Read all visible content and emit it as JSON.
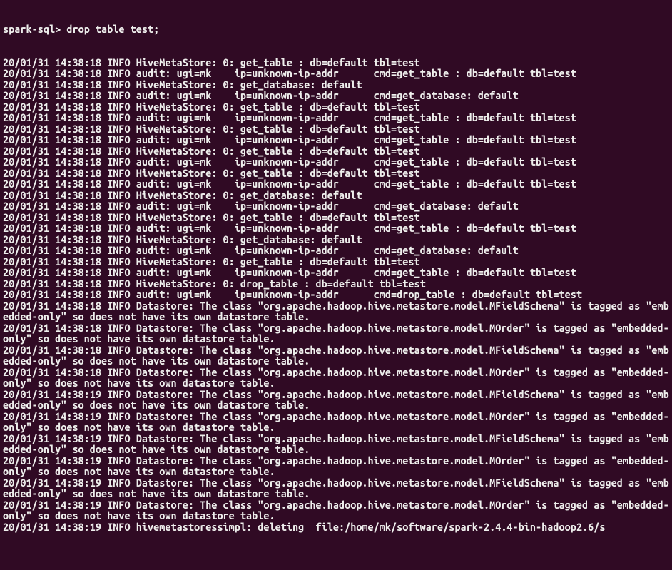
{
  "prompt": "spark-sql> ",
  "command": "drop table test;",
  "lines": [
    "20/01/31 14:38:18 INFO HiveMetaStore: 0: get_table : db=default tbl=test",
    "20/01/31 14:38:18 INFO audit: ugi=mk    ip=unknown-ip-addr      cmd=get_table : db=default tbl=test",
    "20/01/31 14:38:18 INFO HiveMetaStore: 0: get_database: default",
    "20/01/31 14:38:18 INFO audit: ugi=mk    ip=unknown-ip-addr      cmd=get_database: default",
    "20/01/31 14:38:18 INFO HiveMetaStore: 0: get_table : db=default tbl=test",
    "20/01/31 14:38:18 INFO audit: ugi=mk    ip=unknown-ip-addr      cmd=get_table : db=default tbl=test",
    "20/01/31 14:38:18 INFO HiveMetaStore: 0: get_table : db=default tbl=test",
    "20/01/31 14:38:18 INFO audit: ugi=mk    ip=unknown-ip-addr      cmd=get_table : db=default tbl=test",
    "20/01/31 14:38:18 INFO HiveMetaStore: 0: get_table : db=default tbl=test",
    "20/01/31 14:38:18 INFO audit: ugi=mk    ip=unknown-ip-addr      cmd=get_table : db=default tbl=test",
    "20/01/31 14:38:18 INFO HiveMetaStore: 0: get_table : db=default tbl=test",
    "20/01/31 14:38:18 INFO audit: ugi=mk    ip=unknown-ip-addr      cmd=get_table : db=default tbl=test",
    "20/01/31 14:38:18 INFO HiveMetaStore: 0: get_database: default",
    "20/01/31 14:38:18 INFO audit: ugi=mk    ip=unknown-ip-addr      cmd=get_database: default",
    "20/01/31 14:38:18 INFO HiveMetaStore: 0: get_table : db=default tbl=test",
    "20/01/31 14:38:18 INFO audit: ugi=mk    ip=unknown-ip-addr      cmd=get_table : db=default tbl=test",
    "20/01/31 14:38:18 INFO HiveMetaStore: 0: get_database: default",
    "20/01/31 14:38:18 INFO audit: ugi=mk    ip=unknown-ip-addr      cmd=get_database: default",
    "20/01/31 14:38:18 INFO HiveMetaStore: 0: get_table : db=default tbl=test",
    "20/01/31 14:38:18 INFO audit: ugi=mk    ip=unknown-ip-addr      cmd=get_table : db=default tbl=test",
    "20/01/31 14:38:18 INFO HiveMetaStore: 0: drop_table : db=default tbl=test",
    "20/01/31 14:38:18 INFO audit: ugi=mk    ip=unknown-ip-addr      cmd=drop_table : db=default tbl=test",
    "20/01/31 14:38:18 INFO Datastore: The class \"org.apache.hadoop.hive.metastore.model.MFieldSchema\" is tagged as \"embedded-only\" so does not have its own datastore table.",
    "20/01/31 14:38:18 INFO Datastore: The class \"org.apache.hadoop.hive.metastore.model.MOrder\" is tagged as \"embedded-only\" so does not have its own datastore table.",
    "20/01/31 14:38:18 INFO Datastore: The class \"org.apache.hadoop.hive.metastore.model.MFieldSchema\" is tagged as \"embedded-only\" so does not have its own datastore table.",
    "20/01/31 14:38:18 INFO Datastore: The class \"org.apache.hadoop.hive.metastore.model.MOrder\" is tagged as \"embedded-only\" so does not have its own datastore table.",
    "20/01/31 14:38:19 INFO Datastore: The class \"org.apache.hadoop.hive.metastore.model.MFieldSchema\" is tagged as \"embedded-only\" so does not have its own datastore table.",
    "20/01/31 14:38:19 INFO Datastore: The class \"org.apache.hadoop.hive.metastore.model.MOrder\" is tagged as \"embedded-only\" so does not have its own datastore table.",
    "20/01/31 14:38:19 INFO Datastore: The class \"org.apache.hadoop.hive.metastore.model.MFieldSchema\" is tagged as \"embedded-only\" so does not have its own datastore table.",
    "20/01/31 14:38:19 INFO Datastore: The class \"org.apache.hadoop.hive.metastore.model.MOrder\" is tagged as \"embedded-only\" so does not have its own datastore table.",
    "20/01/31 14:38:19 INFO Datastore: The class \"org.apache.hadoop.hive.metastore.model.MFieldSchema\" is tagged as \"embedded-only\" so does not have its own datastore table.",
    "20/01/31 14:38:19 INFO Datastore: The class \"org.apache.hadoop.hive.metastore.model.MOrder\" is tagged as \"embedded-only\" so does not have its own datastore table.",
    "20/01/31 14:38:19 INFO hivemetastoressimpl: deleting  file:/home/mk/software/spark-2.4.4-bin-hadoop2.6/s"
  ]
}
